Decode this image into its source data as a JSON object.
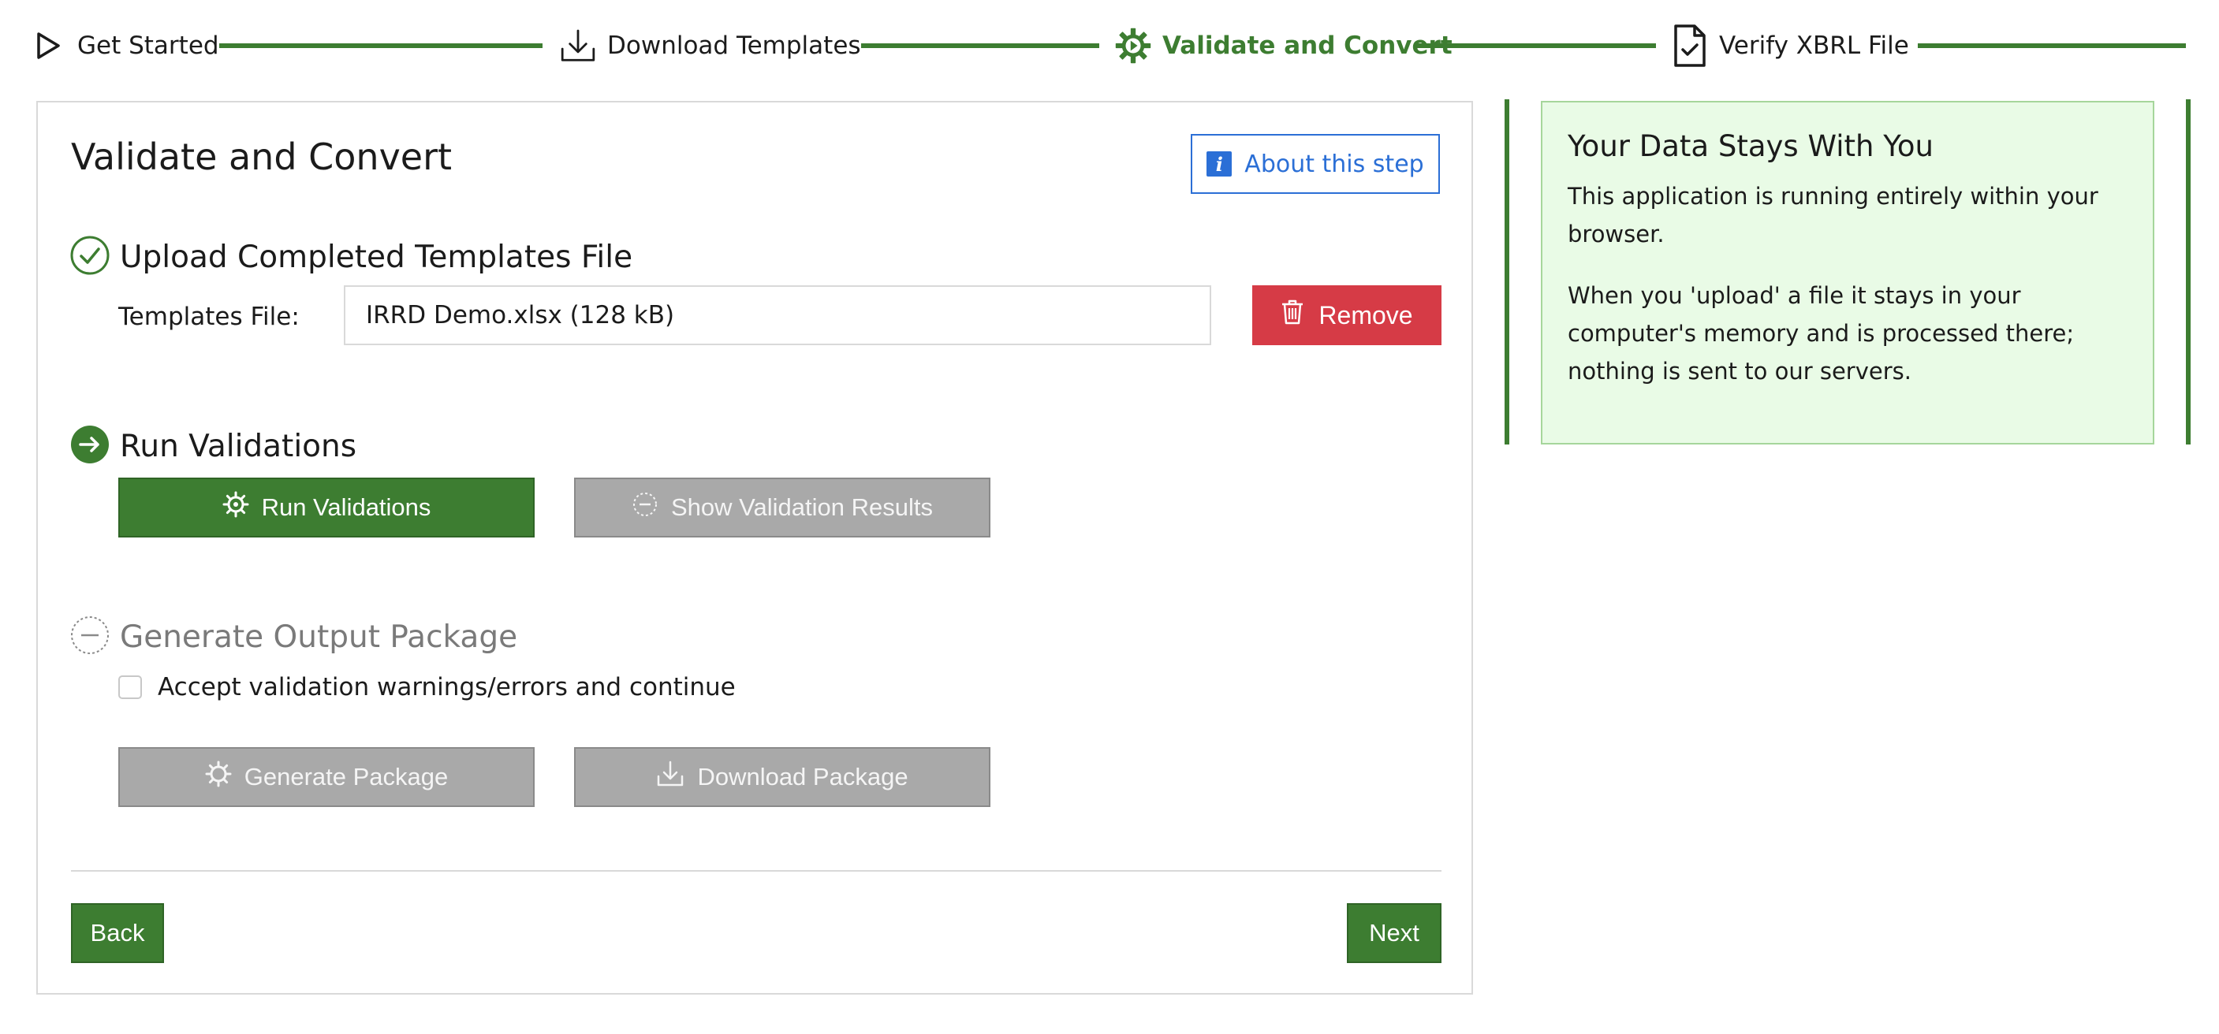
{
  "stepper": {
    "steps": [
      {
        "label": "Get Started",
        "icon": "play-outline-icon",
        "state": "done"
      },
      {
        "label": "Download Templates",
        "icon": "download-icon",
        "state": "done"
      },
      {
        "label": "Validate and Convert",
        "icon": "gear-icon",
        "state": "active"
      },
      {
        "label": "Verify XBRL File",
        "icon": "file-check-icon",
        "state": "pending"
      }
    ]
  },
  "card": {
    "title": "Validate and Convert",
    "about_label": "About this step",
    "upload": {
      "title": "Upload Completed Templates File",
      "status": "complete",
      "file_label": "Templates File:",
      "file_value": "IRRD Demo.xlsx (128 kB)",
      "remove_label": "Remove"
    },
    "validate": {
      "title": "Run Validations",
      "status": "current",
      "run_label": "Run Validations",
      "show_label": "Show Validation Results"
    },
    "generate": {
      "title": "Generate Output Package",
      "status": "disabled",
      "accept_label": "Accept validation warnings/errors and continue",
      "accept_checked": false,
      "generate_label": "Generate Package",
      "download_label": "Download Package"
    },
    "back_label": "Back",
    "next_label": "Next"
  },
  "note": {
    "title": "Your Data Stays With You",
    "p1": "This application is running entirely within your browser.",
    "p2": "When you 'upload' a file it stays in your computer's memory and is processed there; nothing is sent to our servers."
  },
  "colors": {
    "primary_green": "#3d7d31",
    "danger_red": "#d63b46",
    "info_blue": "#2b6fd6",
    "disabled_grey": "#a9a9a9",
    "note_bg": "#e9fbe6"
  }
}
